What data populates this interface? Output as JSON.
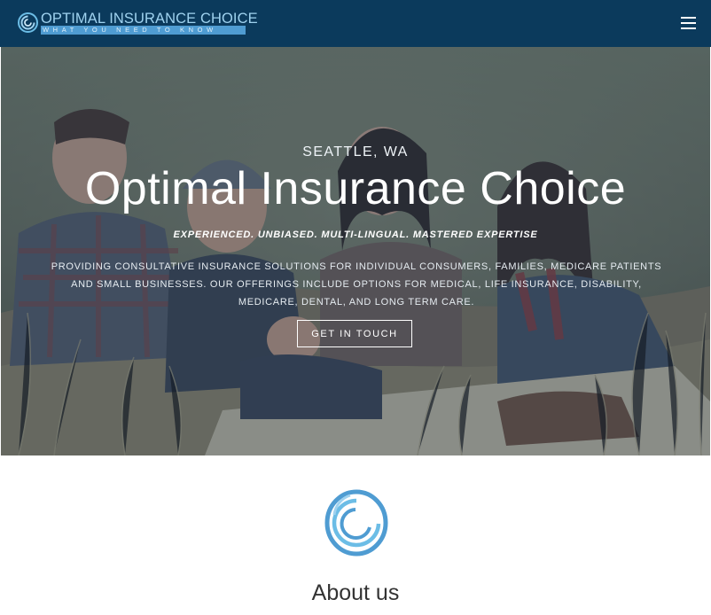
{
  "header": {
    "brand_name": "OPTIMAL INSURANCE CHOICE",
    "brand_tagline": "WHAT YOU NEED TO KNOW",
    "menu_icon": "hamburger-menu-icon",
    "background_color": "#0b3a5c"
  },
  "hero": {
    "location": "SEATTLE, WA",
    "title": "Optimal Insurance Choice",
    "tagline": "EXPERIENCED. UNBIASED. MULTI-LINGUAL. MASTERED EXPERTISE",
    "description": "PROVIDING CONSULTATIVE INSURANCE SOLUTIONS FOR INDIVIDUAL CONSUMERS, FAMILIES, MEDICARE PATIENTS AND SMALL BUSINESSES. OUR OFFERINGS INCLUDE OPTIONS FOR MEDICAL, LIFE INSURANCE, DISABILITY,  MEDICARE, DENTAL, AND LONG TERM CARE.",
    "cta_label": "GET IN TOUCH",
    "background_image": "family-sitting-on-blanket-in-tall-grass-photo"
  },
  "about": {
    "icon": "circular-swirl-logo-icon",
    "title": "About us"
  },
  "colors": {
    "accent": "#4f9cd2",
    "logo_light": "#9fd2ef"
  }
}
